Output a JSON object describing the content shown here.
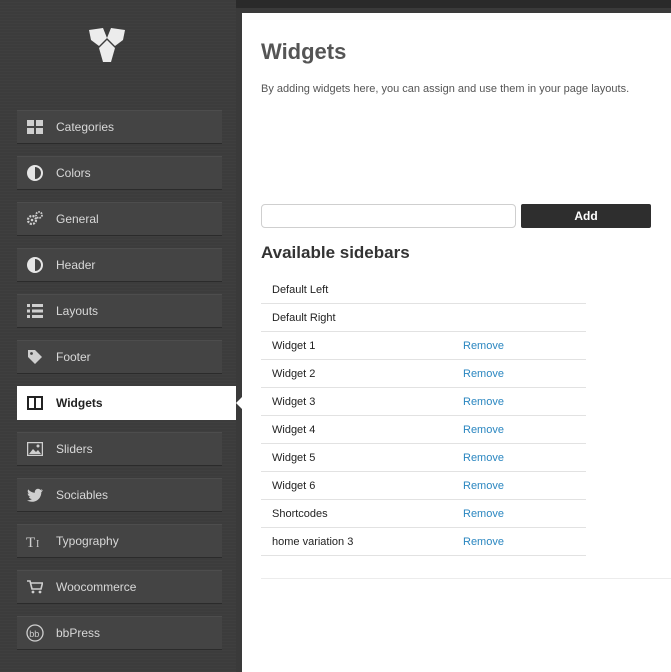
{
  "sidebar": {
    "items": [
      {
        "label": "Categories",
        "icon": "grid-icon"
      },
      {
        "label": "Colors",
        "icon": "contrast-icon"
      },
      {
        "label": "General",
        "icon": "gears-icon"
      },
      {
        "label": "Header",
        "icon": "contrast-icon"
      },
      {
        "label": "Layouts",
        "icon": "list-icon"
      },
      {
        "label": "Footer",
        "icon": "tag-icon"
      },
      {
        "label": "Widgets",
        "icon": "columns-icon",
        "active": true
      },
      {
        "label": "Sliders",
        "icon": "image-icon"
      },
      {
        "label": "Sociables",
        "icon": "twitter-bird-icon"
      },
      {
        "label": "Typography",
        "icon": "text-icon"
      },
      {
        "label": "Woocommerce",
        "icon": "cart-icon"
      },
      {
        "label": "bbPress",
        "icon": "bbpress-icon"
      }
    ]
  },
  "main": {
    "title": "Widgets",
    "description": "By adding widgets here, you can assign and use them in your page layouts.",
    "add_input_value": "",
    "add_button_label": "Add",
    "section_title": "Available sidebars",
    "remove_label": "Remove",
    "sidebars": [
      {
        "name": "Default Left",
        "removable": false
      },
      {
        "name": "Default Right",
        "removable": false
      },
      {
        "name": "Widget 1",
        "removable": true
      },
      {
        "name": "Widget 2",
        "removable": true
      },
      {
        "name": "Widget 3",
        "removable": true
      },
      {
        "name": "Widget 4",
        "removable": true
      },
      {
        "name": "Widget 5",
        "removable": true
      },
      {
        "name": "Widget 6",
        "removable": true
      },
      {
        "name": "Shortcodes",
        "removable": true
      },
      {
        "name": "home variation 3",
        "removable": true
      }
    ]
  },
  "colors": {
    "link": "#2a86c0",
    "sidebar_bg": "#3c3c3c",
    "button_bg": "#2e2e2e"
  }
}
